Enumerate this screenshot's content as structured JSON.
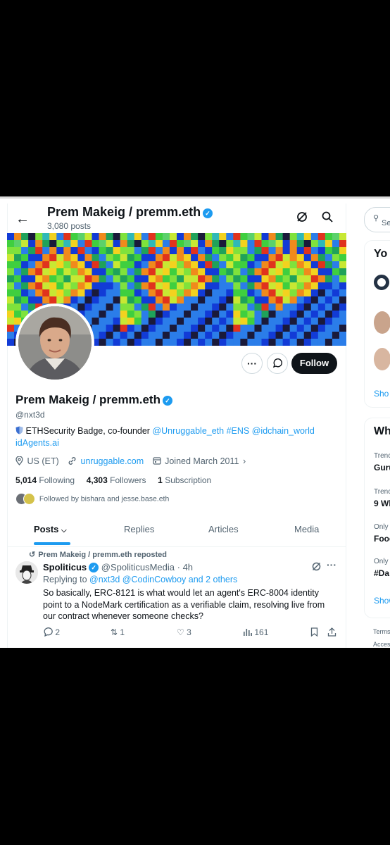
{
  "header": {
    "name": "Prem Makeig / premm.eth",
    "posts": "3,080 posts"
  },
  "profile": {
    "name": "Prem Makeig / premm.eth",
    "handle": "@nxt3d",
    "bio_prefix": "ETHSecurity Badge, co-founder",
    "bio_links": [
      "@Unruggable_eth",
      "#ENS",
      "@idchain_world",
      "idAgents.ai"
    ],
    "location": "US (ET)",
    "website": "unruggable.com",
    "joined": "Joined March 2011",
    "following_count": "5,014",
    "following_label": "Following",
    "followers_count": "4,303",
    "followers_label": "Followers",
    "subscription_count": "1",
    "subscription_label": "Subscription",
    "followed_by": "Followed by bishara and jesse.base.eth",
    "follow_button": "Follow",
    "more_icon": "more-icon",
    "message_icon": "message-icon"
  },
  "tabs": [
    "Posts",
    "Replies",
    "Articles",
    "Media"
  ],
  "tweet": {
    "repost_label": "Prem Makeig / premm.eth reposted",
    "author": "Spoliticus",
    "author_handle": "@SpoliticusMedia",
    "time": "· 4h",
    "replying_prefix": "Replying to",
    "replying_targets": "@nxt3d @CodinCowboy and 2 others",
    "text": "So basically, ERC-8121 is what would let an agent's ERC-8004 identity point to a NodeMark certification as a verifiable claim, resolving live from our contract whenever someone checks?",
    "replies": "2",
    "reposts": "1",
    "likes": "3",
    "views": "161"
  },
  "right_panel": {
    "search_placeholder": "Se",
    "card1_title": "Yo",
    "card1_show": "Sho",
    "card2_title": "Wh",
    "trends": [
      {
        "ctx": "Trenc",
        "name": "Guru"
      },
      {
        "ctx": "Trenc",
        "name": "9 Wh"
      },
      {
        "ctx": "Only",
        "name": "Food"
      },
      {
        "ctx": "Only",
        "name": "#Da"
      }
    ],
    "card2_show": "Show",
    "footer1": "Terms",
    "footer2": "Access"
  },
  "colors": {
    "accent": "#1d9bf0",
    "text": "#0f1419",
    "muted": "#536471"
  }
}
